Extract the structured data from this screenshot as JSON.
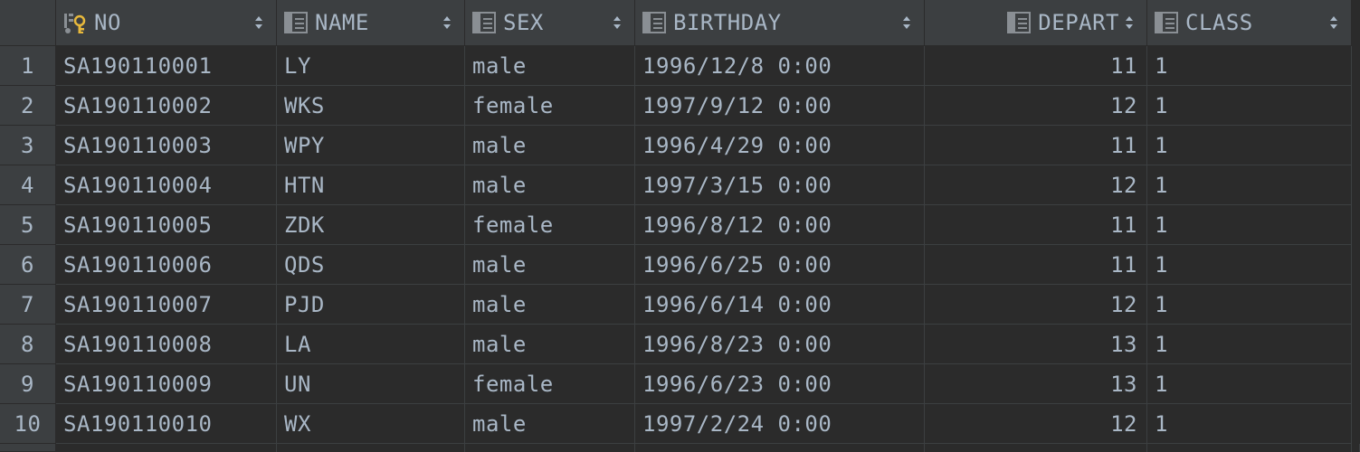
{
  "table": {
    "columns": [
      {
        "label": "NO",
        "icon": "primary-key-column-icon",
        "align": "left"
      },
      {
        "label": "NAME",
        "icon": "column-icon",
        "align": "left"
      },
      {
        "label": "SEX",
        "icon": "column-icon",
        "align": "left"
      },
      {
        "label": "BIRTHDAY",
        "icon": "column-icon",
        "align": "left"
      },
      {
        "label": "DEPART",
        "icon": "column-icon",
        "align": "right"
      },
      {
        "label": "CLASS",
        "icon": "column-icon",
        "align": "left"
      }
    ],
    "rows": [
      {
        "n": "1",
        "cells": [
          "SA190110001",
          "LY",
          "male",
          "1996/12/8 0:00",
          "11",
          "1"
        ]
      },
      {
        "n": "2",
        "cells": [
          "SA190110002",
          "WKS",
          "female",
          "1997/9/12 0:00",
          "12",
          "1"
        ]
      },
      {
        "n": "3",
        "cells": [
          "SA190110003",
          "WPY",
          "male",
          "1996/4/29 0:00",
          "11",
          "1"
        ]
      },
      {
        "n": "4",
        "cells": [
          "SA190110004",
          "HTN",
          "male",
          "1997/3/15 0:00",
          "12",
          "1"
        ]
      },
      {
        "n": "5",
        "cells": [
          "SA190110005",
          "ZDK",
          "female",
          "1996/8/12 0:00",
          "11",
          "1"
        ]
      },
      {
        "n": "6",
        "cells": [
          "SA190110006",
          "QDS",
          "male",
          "1996/6/25 0:00",
          "11",
          "1"
        ]
      },
      {
        "n": "7",
        "cells": [
          "SA190110007",
          "PJD",
          "male",
          "1996/6/14 0:00",
          "12",
          "1"
        ]
      },
      {
        "n": "8",
        "cells": [
          "SA190110008",
          "LA",
          "male",
          "1996/8/23 0:00",
          "13",
          "1"
        ]
      },
      {
        "n": "9",
        "cells": [
          "SA190110009",
          "UN",
          "female",
          "1996/6/23 0:00",
          "13",
          "1"
        ]
      },
      {
        "n": "10",
        "cells": [
          "SA190110010",
          "WX",
          "male",
          "1997/2/24 0:00",
          "12",
          "1"
        ]
      }
    ]
  },
  "colors": {
    "background": "#2b2b2b",
    "header": "#3c3f41",
    "text": "#a9b7c6",
    "key": "#e8b93c"
  }
}
